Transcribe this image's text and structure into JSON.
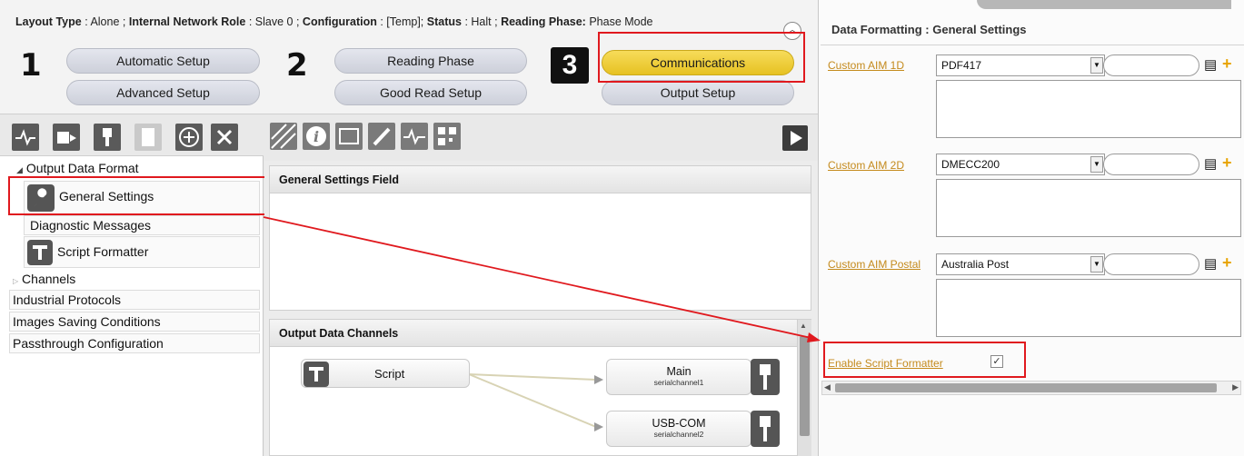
{
  "status": {
    "layout_type_label": "Layout Type",
    "layout_type_value": ": Alone ;",
    "network_role_label": "Internal Network Role",
    "network_role_value": ": Slave 0 ;",
    "configuration_label": "Configuration",
    "configuration_value": ": [Temp];",
    "status_label": "Status",
    "status_value": ": Halt ;",
    "reading_phase_label": "Reading Phase:",
    "reading_phase_value": "Phase Mode"
  },
  "steps": {
    "step1": "1",
    "step2": "2",
    "step3": "3",
    "automatic_setup": "Automatic Setup",
    "advanced_setup": "Advanced Setup",
    "reading_phase": "Reading Phase",
    "good_read_setup": "Good Read Setup",
    "communications": "Communications",
    "output_setup": "Output Setup"
  },
  "tree": {
    "output_data_format": "Output Data Format",
    "general_settings": "General Settings",
    "diagnostic_messages": "Diagnostic Messages",
    "script_formatter": "Script Formatter",
    "channels": "Channels",
    "industrial_protocols": "Industrial Protocols",
    "images_saving_conditions": "Images Saving Conditions",
    "passthrough_configuration": "Passthrough Configuration"
  },
  "center": {
    "general_settings_field": "General Settings Field",
    "output_data_channels": "Output Data Channels",
    "script_node": "Script",
    "main_node": "Main",
    "main_sub": "serialchannel1",
    "usb_node": "USB-COM",
    "usb_sub": "serialchannel2"
  },
  "right": {
    "title": "Data Formatting : General Settings",
    "aim1d_label": "Custom AIM 1D",
    "aim1d_value": "PDF417",
    "aim2d_label": "Custom AIM 2D",
    "aim2d_value": "DMECC200",
    "aimpostal_label": "Custom AIM Postal",
    "aimpostal_value": "Australia Post",
    "enable_script_label": "Enable Script Formatter",
    "enable_script_checked": true
  },
  "colors": {
    "accent_yellow": "#e6c222",
    "highlight_red": "#e0191e",
    "link_orange": "#c48a1c"
  }
}
